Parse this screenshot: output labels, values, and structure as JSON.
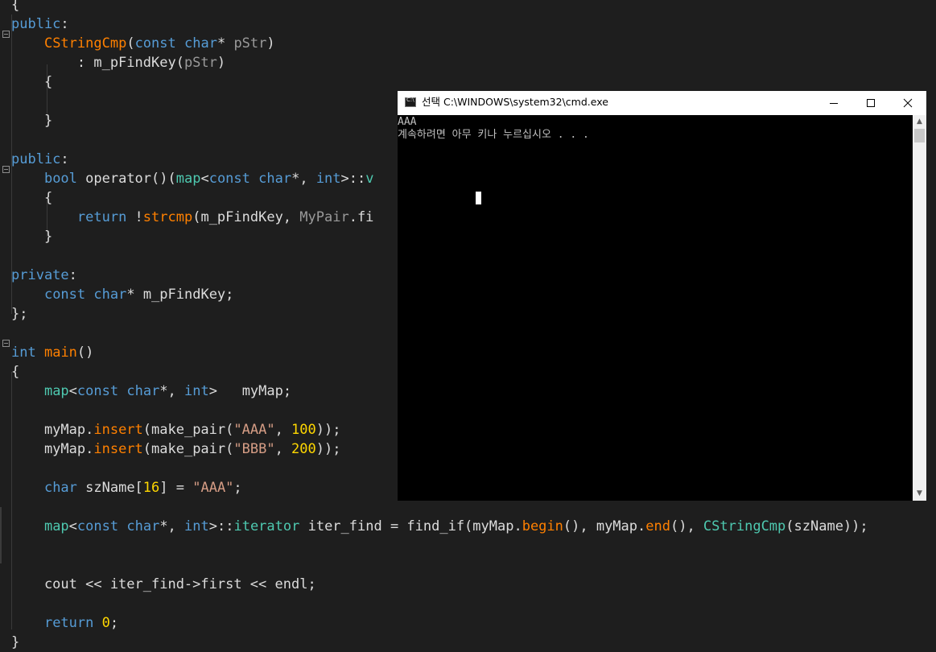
{
  "editor": {
    "lines": [
      {
        "tokens": [
          {
            "t": "{",
            "c": ""
          }
        ]
      },
      {
        "tokens": [
          {
            "t": "public",
            "c": "kw"
          },
          {
            "t": ":",
            "c": ""
          }
        ]
      },
      {
        "tokens": [
          {
            "t": "    ",
            "c": ""
          },
          {
            "t": "CStringCmp",
            "c": "fn"
          },
          {
            "t": "(",
            "c": ""
          },
          {
            "t": "const",
            "c": "kw"
          },
          {
            "t": " ",
            "c": ""
          },
          {
            "t": "char",
            "c": "kw"
          },
          {
            "t": "* ",
            "c": ""
          },
          {
            "t": "pStr",
            "c": "pa"
          },
          {
            "t": ")",
            "c": ""
          }
        ]
      },
      {
        "tokens": [
          {
            "t": "        : m_pFindKey(",
            "c": ""
          },
          {
            "t": "pStr",
            "c": "pa"
          },
          {
            "t": ")",
            "c": ""
          }
        ]
      },
      {
        "tokens": [
          {
            "t": "    {",
            "c": ""
          }
        ]
      },
      {
        "tokens": [
          {
            "t": "",
            "c": ""
          }
        ]
      },
      {
        "tokens": [
          {
            "t": "    }",
            "c": ""
          }
        ]
      },
      {
        "tokens": [
          {
            "t": "",
            "c": ""
          }
        ]
      },
      {
        "tokens": [
          {
            "t": "public",
            "c": "kw"
          },
          {
            "t": ":",
            "c": ""
          }
        ]
      },
      {
        "tokens": [
          {
            "t": "    ",
            "c": ""
          },
          {
            "t": "bool",
            "c": "kw"
          },
          {
            "t": " operator()(",
            "c": ""
          },
          {
            "t": "map",
            "c": "ty"
          },
          {
            "t": "<",
            "c": ""
          },
          {
            "t": "const",
            "c": "kw"
          },
          {
            "t": " ",
            "c": ""
          },
          {
            "t": "char",
            "c": "kw"
          },
          {
            "t": "*, ",
            "c": ""
          },
          {
            "t": "int",
            "c": "kw"
          },
          {
            "t": ">::",
            "c": ""
          },
          {
            "t": "v",
            "c": "ty"
          }
        ]
      },
      {
        "tokens": [
          {
            "t": "    {",
            "c": ""
          }
        ]
      },
      {
        "tokens": [
          {
            "t": "        ",
            "c": ""
          },
          {
            "t": "return",
            "c": "kw"
          },
          {
            "t": " !",
            "c": ""
          },
          {
            "t": "strcmp",
            "c": "fn"
          },
          {
            "t": "(m_pFindKey, ",
            "c": ""
          },
          {
            "t": "MyPair",
            "c": "pa"
          },
          {
            "t": ".fi",
            "c": ""
          }
        ]
      },
      {
        "tokens": [
          {
            "t": "    }",
            "c": ""
          }
        ]
      },
      {
        "tokens": [
          {
            "t": "",
            "c": ""
          }
        ]
      },
      {
        "tokens": [
          {
            "t": "private",
            "c": "kw"
          },
          {
            "t": ":",
            "c": ""
          }
        ]
      },
      {
        "tokens": [
          {
            "t": "    ",
            "c": ""
          },
          {
            "t": "const",
            "c": "kw"
          },
          {
            "t": " ",
            "c": ""
          },
          {
            "t": "char",
            "c": "kw"
          },
          {
            "t": "* m_pFindKey;",
            "c": ""
          }
        ]
      },
      {
        "tokens": [
          {
            "t": "};",
            "c": ""
          }
        ]
      },
      {
        "tokens": [
          {
            "t": "",
            "c": ""
          }
        ]
      },
      {
        "tokens": [
          {
            "t": "int",
            "c": "kw"
          },
          {
            "t": " ",
            "c": ""
          },
          {
            "t": "main",
            "c": "fn"
          },
          {
            "t": "()",
            "c": ""
          }
        ]
      },
      {
        "tokens": [
          {
            "t": "{",
            "c": ""
          }
        ]
      },
      {
        "tokens": [
          {
            "t": "    ",
            "c": ""
          },
          {
            "t": "map",
            "c": "ty"
          },
          {
            "t": "<",
            "c": ""
          },
          {
            "t": "const",
            "c": "kw"
          },
          {
            "t": " ",
            "c": ""
          },
          {
            "t": "char",
            "c": "kw"
          },
          {
            "t": "*, ",
            "c": ""
          },
          {
            "t": "int",
            "c": "kw"
          },
          {
            "t": ">   myMap;",
            "c": ""
          }
        ]
      },
      {
        "tokens": [
          {
            "t": "",
            "c": ""
          }
        ]
      },
      {
        "tokens": [
          {
            "t": "    myMap.",
            "c": ""
          },
          {
            "t": "insert",
            "c": "fn"
          },
          {
            "t": "(make_pair(",
            "c": ""
          },
          {
            "t": "\"AAA\"",
            "c": "st"
          },
          {
            "t": ", ",
            "c": ""
          },
          {
            "t": "100",
            "c": "nu"
          },
          {
            "t": "));",
            "c": ""
          }
        ]
      },
      {
        "tokens": [
          {
            "t": "    myMap.",
            "c": ""
          },
          {
            "t": "insert",
            "c": "fn"
          },
          {
            "t": "(make_pair(",
            "c": ""
          },
          {
            "t": "\"BBB\"",
            "c": "st"
          },
          {
            "t": ", ",
            "c": ""
          },
          {
            "t": "200",
            "c": "nu"
          },
          {
            "t": "));",
            "c": ""
          }
        ]
      },
      {
        "tokens": [
          {
            "t": "",
            "c": ""
          }
        ]
      },
      {
        "tokens": [
          {
            "t": "    ",
            "c": ""
          },
          {
            "t": "char",
            "c": "kw"
          },
          {
            "t": " szName[",
            "c": ""
          },
          {
            "t": "16",
            "c": "nu"
          },
          {
            "t": "] = ",
            "c": ""
          },
          {
            "t": "\"AAA\"",
            "c": "st"
          },
          {
            "t": ";",
            "c": ""
          }
        ]
      },
      {
        "tokens": [
          {
            "t": "",
            "c": ""
          }
        ]
      },
      {
        "tokens": [
          {
            "t": "    ",
            "c": ""
          },
          {
            "t": "map",
            "c": "ty"
          },
          {
            "t": "<",
            "c": ""
          },
          {
            "t": "const",
            "c": "kw"
          },
          {
            "t": " ",
            "c": ""
          },
          {
            "t": "char",
            "c": "kw"
          },
          {
            "t": "*, ",
            "c": ""
          },
          {
            "t": "int",
            "c": "kw"
          },
          {
            "t": ">::",
            "c": ""
          },
          {
            "t": "iterator",
            "c": "ty"
          },
          {
            "t": " iter_find = find_if(myMap.",
            "c": ""
          },
          {
            "t": "begin",
            "c": "fn"
          },
          {
            "t": "(), myMap.",
            "c": ""
          },
          {
            "t": "end",
            "c": "fn"
          },
          {
            "t": "(), ",
            "c": ""
          },
          {
            "t": "CStringCmp",
            "c": "ty"
          },
          {
            "t": "(szName));",
            "c": ""
          }
        ]
      },
      {
        "tokens": [
          {
            "t": "",
            "c": ""
          }
        ]
      },
      {
        "tokens": [
          {
            "t": "",
            "c": ""
          }
        ]
      },
      {
        "tokens": [
          {
            "t": "    cout << iter_find->first << endl;",
            "c": ""
          }
        ]
      },
      {
        "tokens": [
          {
            "t": "",
            "c": ""
          }
        ]
      },
      {
        "tokens": [
          {
            "t": "    ",
            "c": ""
          },
          {
            "t": "return",
            "c": "kw"
          },
          {
            "t": " ",
            "c": ""
          },
          {
            "t": "0",
            "c": "nu"
          },
          {
            "t": ";",
            "c": ""
          }
        ]
      },
      {
        "tokens": [
          {
            "t": "}",
            "c": ""
          }
        ]
      }
    ]
  },
  "console": {
    "title": "선택 C:\\WINDOWS\\system32\\cmd.exe",
    "output": [
      "AAA",
      "계속하려면 아무 키나 누르십시오 . . ."
    ],
    "minimize_icon": "minimize-icon",
    "maximize_icon": "maximize-icon",
    "close_icon": "close-icon"
  },
  "colors": {
    "editor_bg": "#1e1e1e",
    "keyword": "#569cd6",
    "function": "#ff8000",
    "type": "#4ec9b0",
    "number": "#ffd700",
    "string": "#d69d85",
    "parameter": "#9a9a9a",
    "console_bg": "#000000"
  }
}
